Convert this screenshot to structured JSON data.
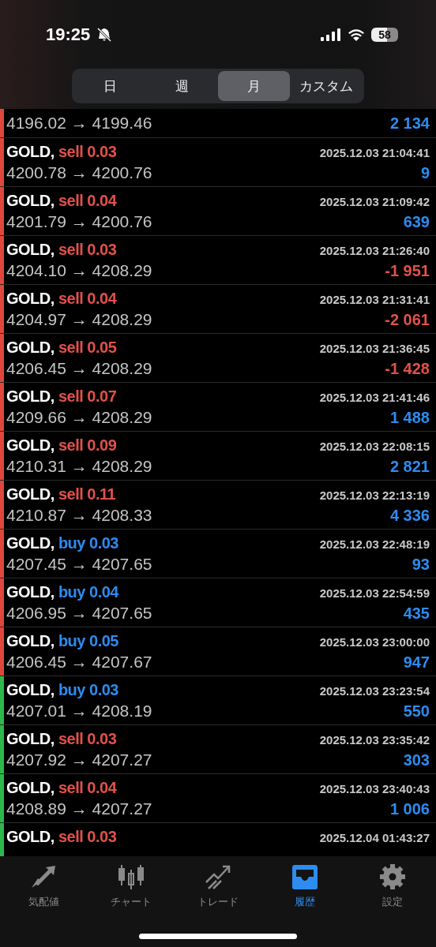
{
  "status_bar": {
    "time": "19:25",
    "battery": "58"
  },
  "periods": [
    {
      "label": "日",
      "selected": false
    },
    {
      "label": "週",
      "selected": false
    },
    {
      "label": "月",
      "selected": true
    },
    {
      "label": "カスタム",
      "selected": false
    }
  ],
  "deals": [
    {
      "kind": "cut",
      "prices": "4196.02 → 4199.46",
      "profit": "2 134",
      "loss": false,
      "color": "#e0463c"
    },
    {
      "kind": "full",
      "symbol": "GOLD,",
      "trade": "sell 0.03",
      "buy": false,
      "time": "2025.12.03 21:04:41",
      "prices": "4200.78 → 4200.76",
      "profit": "9",
      "loss": false,
      "color": "#e0463c"
    },
    {
      "kind": "full",
      "symbol": "GOLD,",
      "trade": "sell 0.04",
      "buy": false,
      "time": "2025.12.03 21:09:42",
      "prices": "4201.79 → 4200.76",
      "profit": "639",
      "loss": false,
      "color": "#e0463c"
    },
    {
      "kind": "full",
      "symbol": "GOLD,",
      "trade": "sell 0.03",
      "buy": false,
      "time": "2025.12.03 21:26:40",
      "prices": "4204.10 → 4208.29",
      "profit": "-1 951",
      "loss": true,
      "color": "#e0463c"
    },
    {
      "kind": "full",
      "symbol": "GOLD,",
      "trade": "sell 0.04",
      "buy": false,
      "time": "2025.12.03 21:31:41",
      "prices": "4204.97 → 4208.29",
      "profit": "-2 061",
      "loss": true,
      "color": "#e0463c"
    },
    {
      "kind": "full",
      "symbol": "GOLD,",
      "trade": "sell 0.05",
      "buy": false,
      "time": "2025.12.03 21:36:45",
      "prices": "4206.45 → 4208.29",
      "profit": "-1 428",
      "loss": true,
      "color": "#e0463c"
    },
    {
      "kind": "full",
      "symbol": "GOLD,",
      "trade": "sell 0.07",
      "buy": false,
      "time": "2025.12.03 21:41:46",
      "prices": "4209.66 → 4208.29",
      "profit": "1 488",
      "loss": false,
      "color": "#e0463c"
    },
    {
      "kind": "full",
      "symbol": "GOLD,",
      "trade": "sell 0.09",
      "buy": false,
      "time": "2025.12.03 22:08:15",
      "prices": "4210.31 → 4208.29",
      "profit": "2 821",
      "loss": false,
      "color": "#e0463c"
    },
    {
      "kind": "full",
      "symbol": "GOLD,",
      "trade": "sell 0.11",
      "buy": false,
      "time": "2025.12.03 22:13:19",
      "prices": "4210.87 → 4208.33",
      "profit": "4 336",
      "loss": false,
      "color": "#e0463c"
    },
    {
      "kind": "full",
      "symbol": "GOLD,",
      "trade": "buy 0.03",
      "buy": true,
      "time": "2025.12.03 22:48:19",
      "prices": "4207.45 → 4207.65",
      "profit": "93",
      "loss": false,
      "color": "#e0463c"
    },
    {
      "kind": "full",
      "symbol": "GOLD,",
      "trade": "buy 0.04",
      "buy": true,
      "time": "2025.12.03 22:54:59",
      "prices": "4206.95 → 4207.65",
      "profit": "435",
      "loss": false,
      "color": "#e0463c"
    },
    {
      "kind": "full",
      "symbol": "GOLD,",
      "trade": "buy 0.05",
      "buy": true,
      "time": "2025.12.03 23:00:00",
      "prices": "4206.45 → 4207.67",
      "profit": "947",
      "loss": false,
      "color": "#e0463c"
    },
    {
      "kind": "full",
      "symbol": "GOLD,",
      "trade": "buy 0.03",
      "buy": true,
      "time": "2025.12.03 23:23:54",
      "prices": "4207.01 → 4208.19",
      "profit": "550",
      "loss": false,
      "color": "#2db84c"
    },
    {
      "kind": "full",
      "symbol": "GOLD,",
      "trade": "sell 0.03",
      "buy": false,
      "time": "2025.12.03 23:35:42",
      "prices": "4207.92 → 4207.27",
      "profit": "303",
      "loss": false,
      "color": "#2db84c"
    },
    {
      "kind": "full",
      "symbol": "GOLD,",
      "trade": "sell 0.04",
      "buy": false,
      "time": "2025.12.03 23:40:43",
      "prices": "4208.89 → 4207.27",
      "profit": "1 006",
      "loss": false,
      "color": "#2db84c"
    },
    {
      "kind": "full",
      "symbol": "GOLD,",
      "trade": "sell 0.03",
      "buy": false,
      "time": "2025.12.04 01:43:27",
      "color": "#2db84c"
    }
  ],
  "tab_bar": [
    {
      "label": "気配値",
      "selected": false
    },
    {
      "label": "チャート",
      "selected": false
    },
    {
      "label": "トレード",
      "selected": false
    },
    {
      "label": "履歴",
      "selected": true
    },
    {
      "label": "設定",
      "selected": false
    }
  ]
}
